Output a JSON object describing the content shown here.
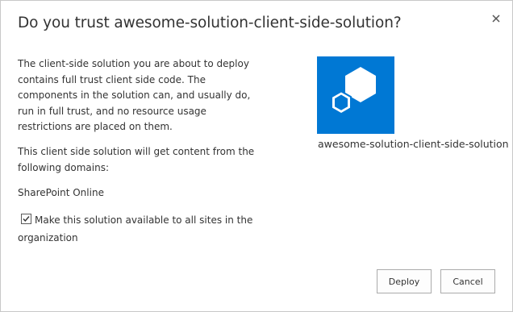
{
  "dialog": {
    "title": "Do you trust awesome-solution-client-side-solution?",
    "close_icon": "close-icon",
    "paragraphs": {
      "trust_warning": "The client-side solution you are about to deploy contains full trust client side code. The components in the solution can, and usually do, run in full trust, and no resource usage restrictions are placed on them.",
      "domains_intro": "This client side solution will get content from the following domains:",
      "domain": "SharePoint Online"
    },
    "checkbox": {
      "label": "Make this solution available to all sites in the organization",
      "checked": true
    },
    "solution": {
      "icon": "solution-package-icon",
      "name": "awesome-solution-client-side-solution",
      "tile_color": "#0078d4"
    },
    "buttons": {
      "deploy": "Deploy",
      "cancel": "Cancel"
    }
  }
}
